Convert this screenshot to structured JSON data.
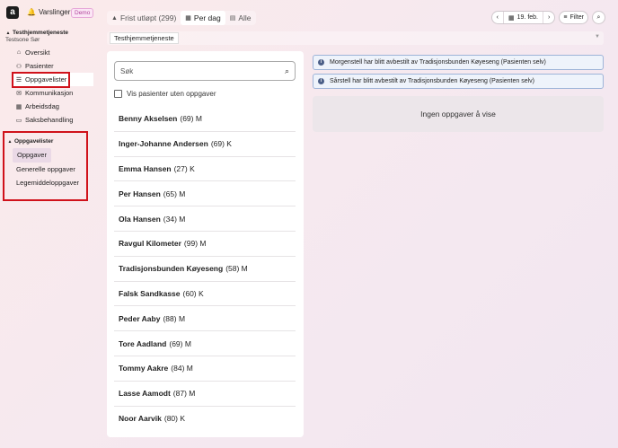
{
  "app": {
    "logo_letter": "a",
    "notifications_label": "Varslinger",
    "demo_badge": "Demo"
  },
  "sidebar": {
    "org_title": "Testhjemmetjeneste",
    "org_subtitle": "Testsone Sør",
    "items": [
      {
        "label": "Oversikt",
        "icon": "home-icon"
      },
      {
        "label": "Pasienter",
        "icon": "people-icon"
      },
      {
        "label": "Oppgavelister",
        "icon": "list-icon",
        "active": true
      },
      {
        "label": "Kommunikasjon",
        "icon": "message-icon"
      },
      {
        "label": "Arbeidsdag",
        "icon": "calendar-icon"
      },
      {
        "label": "Saksbehandling",
        "icon": "folder-icon"
      }
    ],
    "tasks_section": {
      "title": "Oppgavelister",
      "items": [
        {
          "label": "Oppgaver",
          "active": true
        },
        {
          "label": "Generelle oppgaver"
        },
        {
          "label": "Legemiddeloppgaver"
        }
      ]
    }
  },
  "tabs": [
    {
      "label": "Frist utløpt (299)",
      "icon": "warning-icon"
    },
    {
      "label": "Per dag",
      "icon": "calendar-icon",
      "active": true
    },
    {
      "label": "Alle",
      "icon": "grid-icon"
    }
  ],
  "controls": {
    "prev": "‹",
    "date": "19. feb.",
    "next": "›",
    "filter_label": "Filter"
  },
  "unit_selector": {
    "value": "Testhjemmetjeneste"
  },
  "search": {
    "placeholder": "Søk"
  },
  "filter_checkbox_label": "Vis pasienter uten oppgaver",
  "patients": [
    {
      "name": "Benny Akselsen",
      "info": "(69) M"
    },
    {
      "name": "Inger-Johanne Andersen",
      "info": "(69) K"
    },
    {
      "name": "Emma Hansen",
      "info": "(27) K"
    },
    {
      "name": "Per Hansen",
      "info": "(65) M"
    },
    {
      "name": "Ola Hansen",
      "info": "(34) M"
    },
    {
      "name": "Ravgul Kilometer",
      "info": "(99) M"
    },
    {
      "name": "Tradisjonsbunden Køyeseng",
      "info": "(58) M"
    },
    {
      "name": "Falsk Sandkasse",
      "info": "(60) K"
    },
    {
      "name": "Peder Aaby",
      "info": "(88) M"
    },
    {
      "name": "Tore Aadland",
      "info": "(69) M"
    },
    {
      "name": "Tommy Aakre",
      "info": "(84) M"
    },
    {
      "name": "Lasse Aamodt",
      "info": "(87) M"
    },
    {
      "name": "Noor Aarvik",
      "info": "(80) K"
    }
  ],
  "notices": [
    {
      "text": "Morgenstell har blitt avbestilt av Tradisjonsbunden Køyeseng (Pasienten selv)"
    },
    {
      "text": "Sårstell har blitt avbestilt av Tradisjonsbunden Køyeseng (Pasienten selv)"
    }
  ],
  "empty_state": "Ingen oppgaver å vise",
  "colors": {
    "highlight": "#d0121b",
    "notice_border": "#9eb4d8",
    "notice_bg": "#eef3fb",
    "demo": "#b0469c"
  }
}
